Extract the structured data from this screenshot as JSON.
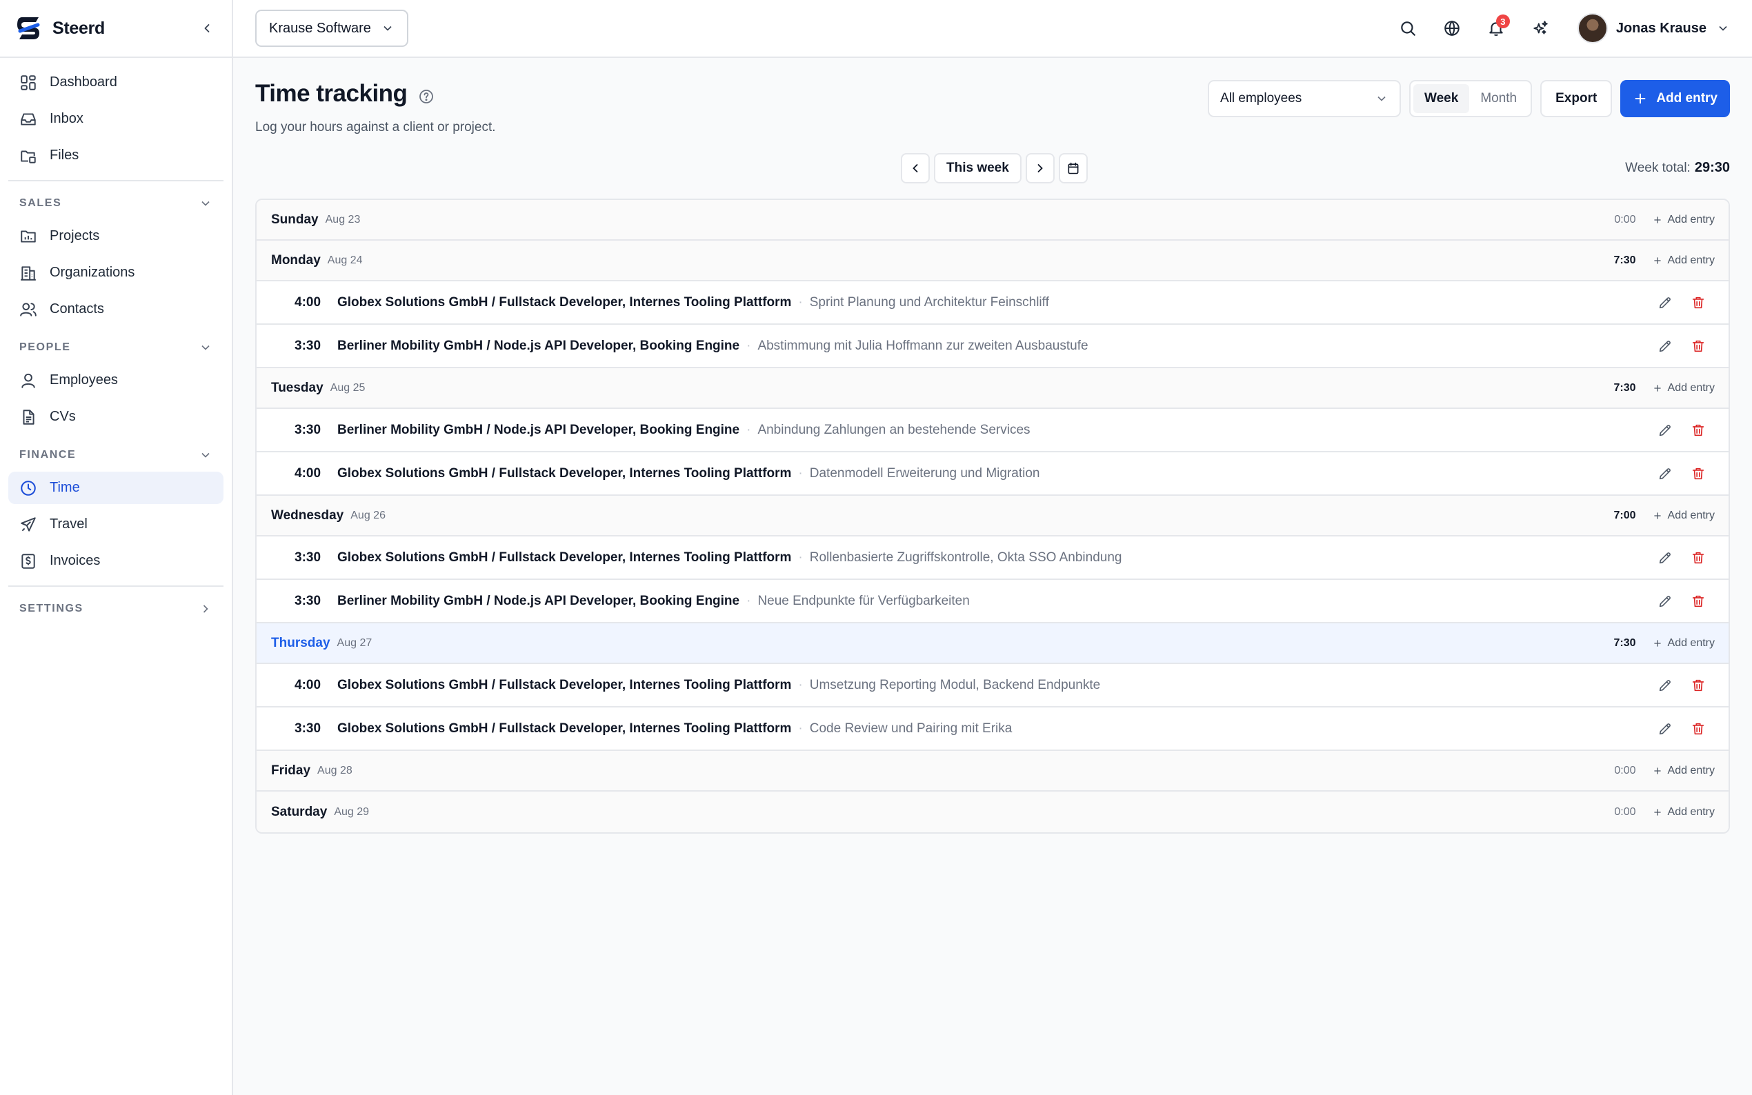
{
  "app": {
    "name": "Steerd"
  },
  "sidebar": {
    "top_items": [
      {
        "label": "Dashboard",
        "icon": "dashboard-icon"
      },
      {
        "label": "Inbox",
        "icon": "inbox-icon"
      },
      {
        "label": "Files",
        "icon": "files-icon"
      }
    ],
    "sections": [
      {
        "title": "SALES",
        "items": [
          {
            "label": "Projects",
            "icon": "folder-icon"
          },
          {
            "label": "Organizations",
            "icon": "building-icon"
          },
          {
            "label": "Contacts",
            "icon": "contacts-icon"
          }
        ]
      },
      {
        "title": "PEOPLE",
        "items": [
          {
            "label": "Employees",
            "icon": "user-icon"
          },
          {
            "label": "CVs",
            "icon": "document-icon"
          }
        ]
      },
      {
        "title": "FINANCE",
        "items": [
          {
            "label": "Time",
            "icon": "clock-icon",
            "active": true
          },
          {
            "label": "Travel",
            "icon": "plane-icon"
          },
          {
            "label": "Invoices",
            "icon": "invoice-icon"
          }
        ]
      }
    ],
    "settings_label": "SETTINGS"
  },
  "topbar": {
    "organization": "Krause Software",
    "notification_count": "3",
    "user_name": "Jonas Krause"
  },
  "page": {
    "title": "Time tracking",
    "subtitle": "Log your hours against a client or project.",
    "employee_filter": "All employees",
    "view_week": "Week",
    "view_month": "Month",
    "active_view": "Week",
    "export_label": "Export",
    "add_entry_label": "Add entry",
    "week_label": "This week",
    "week_total_label": "Week total:",
    "week_total": "29:30"
  },
  "days": [
    {
      "name": "Sunday",
      "date": "Aug 23",
      "total": "0:00",
      "add_label": "Add entry",
      "entries": []
    },
    {
      "name": "Monday",
      "date": "Aug 24",
      "total": "7:30",
      "add_label": "Add entry",
      "entries": [
        {
          "duration": "4:00",
          "project": "Globex Solutions GmbH / Fullstack Developer, Internes Tooling Plattform",
          "description": "Sprint Planung und Architektur Feinschliff"
        },
        {
          "duration": "3:30",
          "project": "Berliner Mobility GmbH / Node.js API Developer, Booking Engine",
          "description": "Abstimmung mit Julia Hoffmann zur zweiten Ausbaustufe"
        }
      ]
    },
    {
      "name": "Tuesday",
      "date": "Aug 25",
      "total": "7:30",
      "add_label": "Add entry",
      "entries": [
        {
          "duration": "3:30",
          "project": "Berliner Mobility GmbH / Node.js API Developer, Booking Engine",
          "description": "Anbindung Zahlungen an bestehende Services"
        },
        {
          "duration": "4:00",
          "project": "Globex Solutions GmbH / Fullstack Developer, Internes Tooling Plattform",
          "description": "Datenmodell Erweiterung und Migration"
        }
      ]
    },
    {
      "name": "Wednesday",
      "date": "Aug 26",
      "total": "7:00",
      "add_label": "Add entry",
      "entries": [
        {
          "duration": "3:30",
          "project": "Globex Solutions GmbH / Fullstack Developer, Internes Tooling Plattform",
          "description": "Rollenbasierte Zugriffskontrolle, Okta SSO Anbindung"
        },
        {
          "duration": "3:30",
          "project": "Berliner Mobility GmbH / Node.js API Developer, Booking Engine",
          "description": "Neue Endpunkte für Verfügbarkeiten"
        }
      ]
    },
    {
      "name": "Thursday",
      "date": "Aug 27",
      "total": "7:30",
      "add_label": "Add entry",
      "today": true,
      "entries": [
        {
          "duration": "4:00",
          "project": "Globex Solutions GmbH / Fullstack Developer, Internes Tooling Plattform",
          "description": "Umsetzung Reporting Modul, Backend Endpunkte"
        },
        {
          "duration": "3:30",
          "project": "Globex Solutions GmbH / Fullstack Developer, Internes Tooling Plattform",
          "description": "Code Review und Pairing mit Erika"
        }
      ]
    },
    {
      "name": "Friday",
      "date": "Aug 28",
      "total": "0:00",
      "add_label": "Add entry",
      "entries": []
    },
    {
      "name": "Saturday",
      "date": "Aug 29",
      "total": "0:00",
      "add_label": "Add entry",
      "entries": []
    }
  ],
  "colors": {
    "accent": "#1d5ee8",
    "danger": "#dc2626",
    "active_nav_bg": "#eef2fb",
    "today_bg": "#f0f5ff"
  }
}
